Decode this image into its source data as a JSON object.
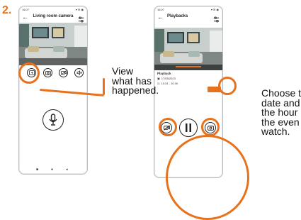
{
  "step_number": "2.",
  "phone_left": {
    "status_time": "16:07",
    "status_icons": "▾ ✉ ◉",
    "title": "Living room camera",
    "back_icon": "back-arrow-icon",
    "menu_icon": "settings-sliders-icon",
    "controls": [
      "playback-icon",
      "camera-icon",
      "camera-off-icon",
      "mute-icon"
    ],
    "mic_icon": "microphone-icon",
    "nav": [
      "■",
      "●",
      "◂"
    ]
  },
  "phone_right": {
    "status_time": "16:07",
    "status_icons": "▾ ✉ ◉",
    "title": "Playbacks",
    "back_icon": "back-arrow-icon",
    "menu_icon": "settings-sliders-icon",
    "video_timestamp": "09:05 • 10:30",
    "meta_label": "Playback",
    "date": "17/05/2023",
    "time": "10:24 - 10:30",
    "orange_box_text": ""
  },
  "annotation_left": [
    "View",
    "what has",
    "happened."
  ],
  "annotation_right": [
    "Choose t",
    "date and",
    "the hour",
    "the even",
    "watch."
  ],
  "colors": {
    "accent": "#e8711c",
    "text": "#111111",
    "phone_border": "#b9bcc2"
  }
}
